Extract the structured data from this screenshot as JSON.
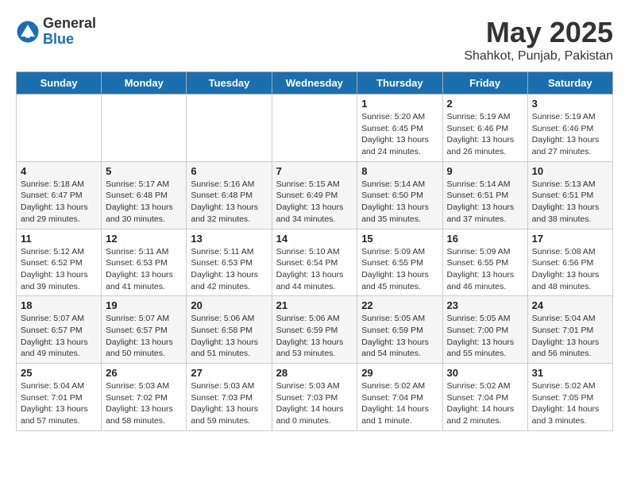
{
  "logo": {
    "general": "General",
    "blue": "Blue"
  },
  "title": "May 2025",
  "location": "Shahkot, Punjab, Pakistan",
  "days_of_week": [
    "Sunday",
    "Monday",
    "Tuesday",
    "Wednesday",
    "Thursday",
    "Friday",
    "Saturday"
  ],
  "weeks": [
    [
      {
        "day": "",
        "info": ""
      },
      {
        "day": "",
        "info": ""
      },
      {
        "day": "",
        "info": ""
      },
      {
        "day": "",
        "info": ""
      },
      {
        "day": "1",
        "info": "Sunrise: 5:20 AM\nSunset: 6:45 PM\nDaylight: 13 hours\nand 24 minutes."
      },
      {
        "day": "2",
        "info": "Sunrise: 5:19 AM\nSunset: 6:46 PM\nDaylight: 13 hours\nand 26 minutes."
      },
      {
        "day": "3",
        "info": "Sunrise: 5:19 AM\nSunset: 6:46 PM\nDaylight: 13 hours\nand 27 minutes."
      }
    ],
    [
      {
        "day": "4",
        "info": "Sunrise: 5:18 AM\nSunset: 6:47 PM\nDaylight: 13 hours\nand 29 minutes."
      },
      {
        "day": "5",
        "info": "Sunrise: 5:17 AM\nSunset: 6:48 PM\nDaylight: 13 hours\nand 30 minutes."
      },
      {
        "day": "6",
        "info": "Sunrise: 5:16 AM\nSunset: 6:48 PM\nDaylight: 13 hours\nand 32 minutes."
      },
      {
        "day": "7",
        "info": "Sunrise: 5:15 AM\nSunset: 6:49 PM\nDaylight: 13 hours\nand 34 minutes."
      },
      {
        "day": "8",
        "info": "Sunrise: 5:14 AM\nSunset: 6:50 PM\nDaylight: 13 hours\nand 35 minutes."
      },
      {
        "day": "9",
        "info": "Sunrise: 5:14 AM\nSunset: 6:51 PM\nDaylight: 13 hours\nand 37 minutes."
      },
      {
        "day": "10",
        "info": "Sunrise: 5:13 AM\nSunset: 6:51 PM\nDaylight: 13 hours\nand 38 minutes."
      }
    ],
    [
      {
        "day": "11",
        "info": "Sunrise: 5:12 AM\nSunset: 6:52 PM\nDaylight: 13 hours\nand 39 minutes."
      },
      {
        "day": "12",
        "info": "Sunrise: 5:11 AM\nSunset: 6:53 PM\nDaylight: 13 hours\nand 41 minutes."
      },
      {
        "day": "13",
        "info": "Sunrise: 5:11 AM\nSunset: 6:53 PM\nDaylight: 13 hours\nand 42 minutes."
      },
      {
        "day": "14",
        "info": "Sunrise: 5:10 AM\nSunset: 6:54 PM\nDaylight: 13 hours\nand 44 minutes."
      },
      {
        "day": "15",
        "info": "Sunrise: 5:09 AM\nSunset: 6:55 PM\nDaylight: 13 hours\nand 45 minutes."
      },
      {
        "day": "16",
        "info": "Sunrise: 5:09 AM\nSunset: 6:55 PM\nDaylight: 13 hours\nand 46 minutes."
      },
      {
        "day": "17",
        "info": "Sunrise: 5:08 AM\nSunset: 6:56 PM\nDaylight: 13 hours\nand 48 minutes."
      }
    ],
    [
      {
        "day": "18",
        "info": "Sunrise: 5:07 AM\nSunset: 6:57 PM\nDaylight: 13 hours\nand 49 minutes."
      },
      {
        "day": "19",
        "info": "Sunrise: 5:07 AM\nSunset: 6:57 PM\nDaylight: 13 hours\nand 50 minutes."
      },
      {
        "day": "20",
        "info": "Sunrise: 5:06 AM\nSunset: 6:58 PM\nDaylight: 13 hours\nand 51 minutes."
      },
      {
        "day": "21",
        "info": "Sunrise: 5:06 AM\nSunset: 6:59 PM\nDaylight: 13 hours\nand 53 minutes."
      },
      {
        "day": "22",
        "info": "Sunrise: 5:05 AM\nSunset: 6:59 PM\nDaylight: 13 hours\nand 54 minutes."
      },
      {
        "day": "23",
        "info": "Sunrise: 5:05 AM\nSunset: 7:00 PM\nDaylight: 13 hours\nand 55 minutes."
      },
      {
        "day": "24",
        "info": "Sunrise: 5:04 AM\nSunset: 7:01 PM\nDaylight: 13 hours\nand 56 minutes."
      }
    ],
    [
      {
        "day": "25",
        "info": "Sunrise: 5:04 AM\nSunset: 7:01 PM\nDaylight: 13 hours\nand 57 minutes."
      },
      {
        "day": "26",
        "info": "Sunrise: 5:03 AM\nSunset: 7:02 PM\nDaylight: 13 hours\nand 58 minutes."
      },
      {
        "day": "27",
        "info": "Sunrise: 5:03 AM\nSunset: 7:03 PM\nDaylight: 13 hours\nand 59 minutes."
      },
      {
        "day": "28",
        "info": "Sunrise: 5:03 AM\nSunset: 7:03 PM\nDaylight: 14 hours\nand 0 minutes."
      },
      {
        "day": "29",
        "info": "Sunrise: 5:02 AM\nSunset: 7:04 PM\nDaylight: 14 hours\nand 1 minute."
      },
      {
        "day": "30",
        "info": "Sunrise: 5:02 AM\nSunset: 7:04 PM\nDaylight: 14 hours\nand 2 minutes."
      },
      {
        "day": "31",
        "info": "Sunrise: 5:02 AM\nSunset: 7:05 PM\nDaylight: 14 hours\nand 3 minutes."
      }
    ]
  ]
}
